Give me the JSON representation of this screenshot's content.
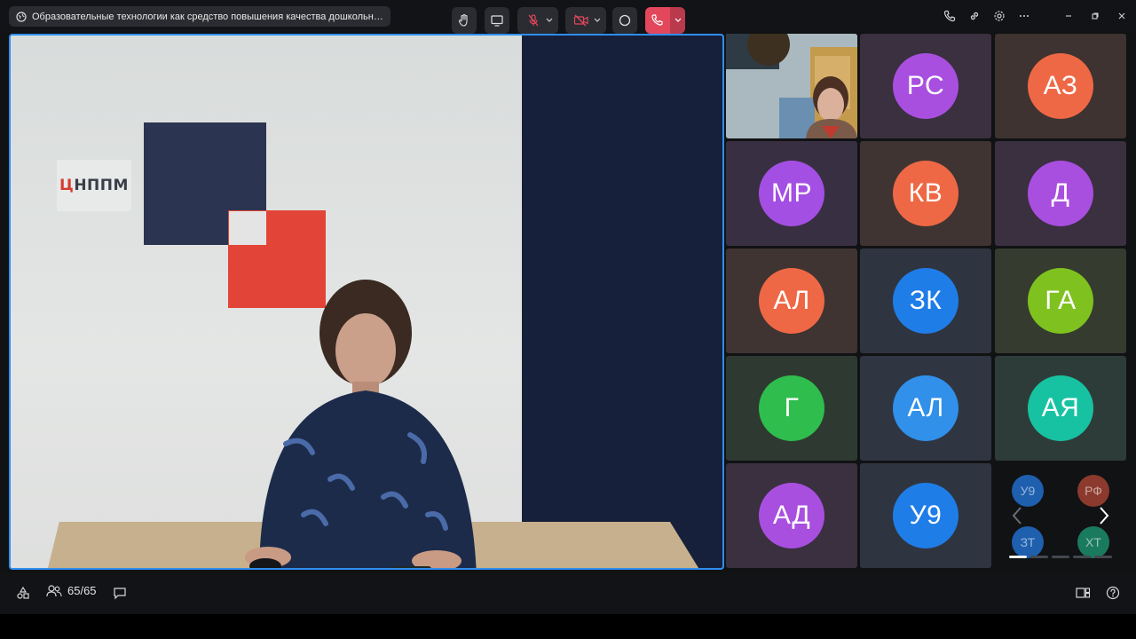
{
  "window": {
    "title": "Образовательные технологии как средство повышения качества дошкольного ...",
    "title_icon": "globe-icon"
  },
  "titlebar_icons": [
    "phone-icon",
    "link-icon",
    "gear-icon",
    "more-icon"
  ],
  "window_controls": [
    "minimize",
    "restore",
    "close"
  ],
  "main_video": {
    "logo_text": "ЦНППМ",
    "border_color": "#2f8ef2"
  },
  "participants": [
    {
      "initials": "",
      "type": "camera"
    },
    {
      "initials": "РС",
      "color": "#a94fe0",
      "bg": "#3a3040"
    },
    {
      "initials": "АЗ",
      "color": "#ef6845",
      "bg": "#3e3330"
    },
    {
      "initials": "МР",
      "color": "#a44fe3",
      "bg": "#383042"
    },
    {
      "initials": "КВ",
      "color": "#ef6845",
      "bg": "#3f3432"
    },
    {
      "initials": "Д",
      "color": "#a94fe0",
      "bg": "#3a3040"
    },
    {
      "initials": "АЛ",
      "color": "#ef6845",
      "bg": "#3f3432"
    },
    {
      "initials": "ЗК",
      "color": "#1f7de8",
      "bg": "#2f3540"
    },
    {
      "initials": "ГА",
      "color": "#7fc21f",
      "bg": "#353b2e"
    },
    {
      "initials": "Г",
      "color": "#2fbd4d",
      "bg": "#2e3a31"
    },
    {
      "initials": "АЛ",
      "color": "#3090ea",
      "bg": "#2f3642"
    },
    {
      "initials": "АЯ",
      "color": "#17c2a2",
      "bg": "#2e3c39"
    },
    {
      "initials": "АД",
      "color": "#a94fe0",
      "bg": "#3a3040"
    },
    {
      "initials": "У9",
      "color": "#1f7de8",
      "bg": "#2f3540"
    }
  ],
  "more_participants": [
    {
      "initials": "У9",
      "color": "#1e5fae"
    },
    {
      "initials": "РФ",
      "color": "#8c3a2e"
    },
    {
      "initials": "ЗТ",
      "color": "#1e5fae"
    },
    {
      "initials": "ХТ",
      "color": "#1a7a5e"
    }
  ],
  "toolbar": {
    "participant_count": "65/65",
    "buttons": [
      "raise-hand",
      "share-screen",
      "microphone-muted",
      "camera-off",
      "record",
      "leave-call"
    ]
  }
}
